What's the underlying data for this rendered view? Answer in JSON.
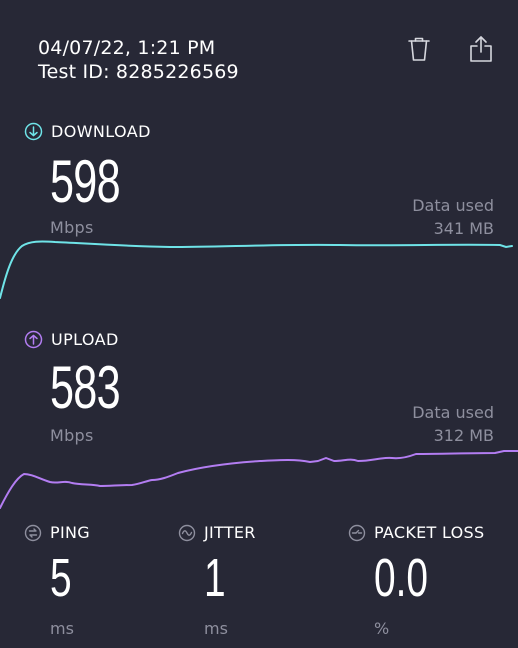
{
  "header": {
    "datetime": "04/07/22, 1:21 PM",
    "test_id": "Test ID: 8285226569"
  },
  "actions": {
    "delete_icon": "trash-icon",
    "share_icon": "share-icon"
  },
  "download": {
    "label": "DOWNLOAD",
    "value": "598",
    "unit": "Mbps",
    "data_used_label": "Data used",
    "data_used_value": "341 MB",
    "color": "#6fe4e8",
    "icon": "arrow-down-circle-icon"
  },
  "upload": {
    "label": "UPLOAD",
    "value": "583",
    "unit": "Mbps",
    "data_used_label": "Data used",
    "data_used_value": "312 MB",
    "color": "#b37df2",
    "icon": "arrow-up-circle-icon"
  },
  "metrics": [
    {
      "label": "PING",
      "value": "5",
      "unit": "ms",
      "icon": "ping-icon"
    },
    {
      "label": "JITTER",
      "value": "1",
      "unit": "ms",
      "icon": "jitter-icon"
    },
    {
      "label": "PACKET LOSS",
      "value": "0.0",
      "unit": "%",
      "icon": "packet-loss-icon"
    }
  ],
  "colors": {
    "background": "#272836",
    "muted": "#8e8f9e"
  }
}
